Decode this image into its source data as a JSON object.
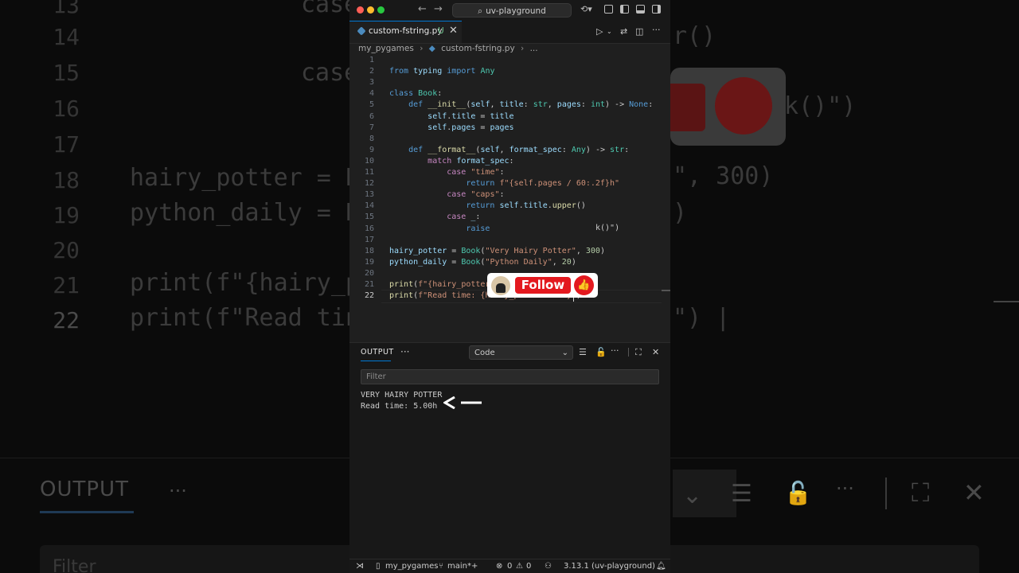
{
  "window": {
    "search_text": "uv-playground"
  },
  "tab": {
    "filename": "custom-fstring.py",
    "status": "U"
  },
  "breadcrumb": {
    "folder": "my_pygames",
    "file": "custom-fstring.py",
    "more": "..."
  },
  "editor": {
    "lines": [
      {
        "n": "1",
        "text": ""
      },
      {
        "n": "2",
        "text": "from typing import Any"
      },
      {
        "n": "3",
        "text": ""
      },
      {
        "n": "4",
        "text": "class Book:"
      },
      {
        "n": "5",
        "text": "    def __init__(self, title: str, pages: int) -> None:"
      },
      {
        "n": "6",
        "text": "        self.title = title"
      },
      {
        "n": "7",
        "text": "        self.pages = pages"
      },
      {
        "n": "8",
        "text": ""
      },
      {
        "n": "9",
        "text": "    def __format__(self, format_spec: Any) -> str:"
      },
      {
        "n": "10",
        "text": "        match format_spec:"
      },
      {
        "n": "11",
        "text": "            case \"time\":"
      },
      {
        "n": "12",
        "text": "                return f\"{self.pages / 60:.2f}h\""
      },
      {
        "n": "13",
        "text": "            case \"caps\":"
      },
      {
        "n": "14",
        "text": "                return self.title.upper()"
      },
      {
        "n": "15",
        "text": "            case _:"
      },
      {
        "n": "16",
        "text": "                raise"
      },
      {
        "n": "17",
        "text": ""
      },
      {
        "n": "18",
        "text": "hairy_potter = Book(\"Very Hairy Potter\", 300)"
      },
      {
        "n": "19",
        "text": "python_daily = Book(\"Python Daily\", 20)"
      },
      {
        "n": "20",
        "text": ""
      },
      {
        "n": "21",
        "text": "print(f\"{hairy_potter:caps}\")"
      },
      {
        "n": "22",
        "text": "print(f\"Read time: {hairy_potter:time}\")"
      }
    ],
    "line16_tail": "k()\")"
  },
  "overlay": {
    "follow_label": "Follow"
  },
  "panel": {
    "title": "OUTPUT",
    "more": "···",
    "channel": "Code",
    "filter_placeholder": "Filter",
    "output_lines": [
      "VERY HAIRY POTTER",
      "Read time: 5.00h"
    ]
  },
  "statusbar": {
    "branch_folder": "my_pygames",
    "branch": "main*+",
    "errors": "0",
    "warnings": "0",
    "python": "3.13.1 (uv-playground)"
  },
  "background": {
    "line_numbers": [
      "13",
      "14",
      "15",
      "16",
      "17",
      "18",
      "19",
      "20",
      "21",
      "22"
    ],
    "code_left": [
      "case",
      "",
      "case",
      "",
      "",
      "hairy_potter = B",
      "python_daily = B",
      "",
      "print(f\"{hairy_p",
      "print(f\"Read tin"
    ],
    "code_right": [
      "r()",
      "k()\")",
      "\", 300)",
      ")",
      "\") |"
    ],
    "output_label": "OUTPUT",
    "output_dots": "···",
    "filter_label": "Filter"
  }
}
